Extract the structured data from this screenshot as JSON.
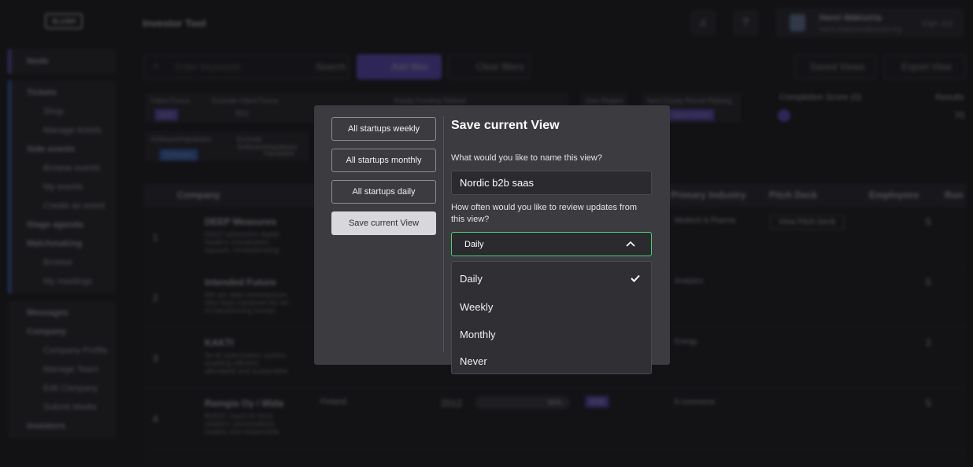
{
  "app": {
    "logo": "SLUSH",
    "title": "Investor Tool",
    "user_name": "Henri Mäkivirta",
    "user_email": "henri.makivirta@slush.org",
    "sign_out": "Sign out"
  },
  "sidebar": {
    "groups": [
      {
        "items": [
          "Node"
        ]
      },
      {
        "items": [
          "Tickets",
          "Shop",
          "Manage tickets",
          "Side events",
          "Browse events",
          "My events",
          "Create an event",
          "Stage agenda",
          "Matchmaking",
          "Browse",
          "My meetings"
        ]
      },
      {
        "items": [
          "Messages",
          "Company",
          "Company Profile",
          "Manage Team",
          "Edit Company",
          "Submit Media",
          "Investors"
        ]
      }
    ]
  },
  "toolbar": {
    "search_placeholder": "Enter keywords",
    "search_label": "Search",
    "add_filter": "Add filter",
    "clear_filters": "Clear filters",
    "saved_views": "Saved Views",
    "export_view": "Export View"
  },
  "filters": {
    "client_focus": "Client Focus",
    "client_focus_val": "B2B",
    "exclude_client_focus": "Exclude Client Focus",
    "exclude_client_focus_val": "B2C",
    "equity": "Equity Funding Raised",
    "geo": "Geo Region",
    "next_round": "Next Equity Round Raising",
    "next_round_val": "Seed round",
    "completion": "Completion Score (0)",
    "results": "Results",
    "results_val": "70",
    "software": "Software/Hardware",
    "software_val": "Software",
    "exclude_software": "Exclude Software/Hardware",
    "exclude_software_val": "Hardware"
  },
  "table": {
    "headers": [
      "Company",
      "Primary Industry",
      "Pitch Deck",
      "Employees",
      "Run"
    ],
    "rows": [
      {
        "num": "1",
        "name": "DEEP Measures",
        "desc": "DEEP addresses digital health's coordination vacuum, revolutionising",
        "industry": "Medtech & Pharma",
        "pitch": "View Pitch Deck",
        "emp": "5"
      },
      {
        "num": "2",
        "name": "Intended Future",
        "desc": "We are data connoisseurs who have mastered the art of transforming human",
        "industry": "Analytics",
        "pitch": "",
        "emp": "5"
      },
      {
        "num": "3",
        "name": "KAKTI",
        "desc": "An AI optimisation system enabling efficient, affordable and sustainable",
        "industry": "Energy",
        "pitch": "",
        "emp": "2"
      },
      {
        "num": "4",
        "name": "Ramgia Oy / Mida",
        "desc": "B2B2C SaaS for food retailers: personalised, healthy and responsible",
        "country": "Finland",
        "year": "2012",
        "pct": "80%",
        "focus": "B2B",
        "industry": "E-commerce",
        "pitch": "",
        "emp": "5"
      }
    ]
  },
  "modal": {
    "views": [
      "All startups weekly",
      "All startups monthly",
      "All startups daily",
      "Save current View"
    ],
    "title": "Save current View",
    "name_label": "What would you like to name this view?",
    "name_value": "Nordic b2b saas",
    "freq_label": "How often would you like to review updates from this view?",
    "selected": "Daily",
    "options": [
      "Daily",
      "Weekly",
      "Monthly",
      "Never"
    ]
  },
  "colors": {
    "accent_purple": "#7a5ce0",
    "accent_green": "#4fcf70",
    "modal_bg": "#3b3b40"
  }
}
